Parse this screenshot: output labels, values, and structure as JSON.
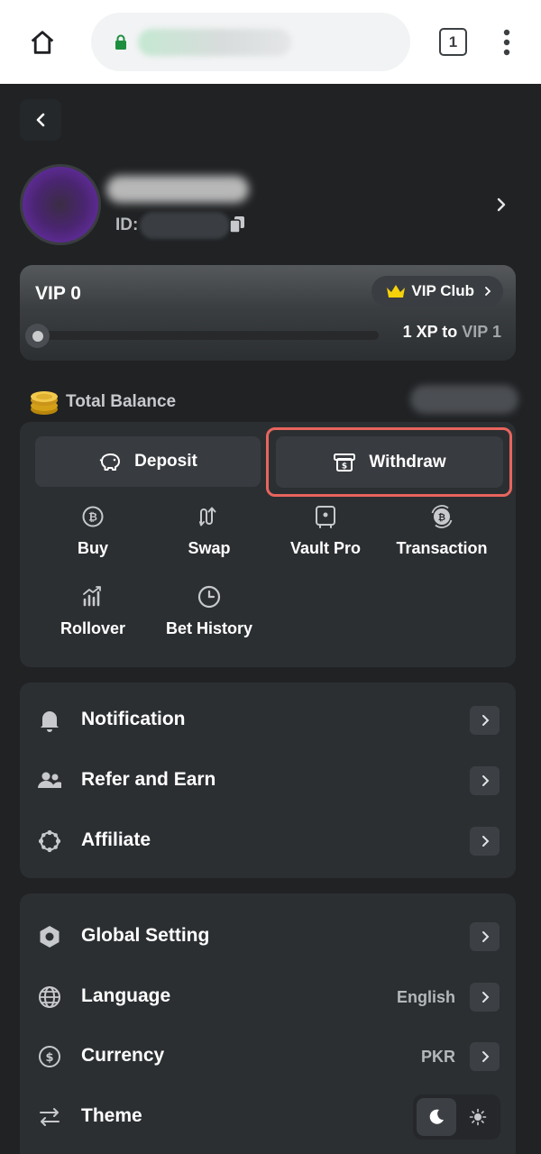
{
  "browser": {
    "tab_count": "1"
  },
  "profile": {
    "id_label": "ID:"
  },
  "vip": {
    "level": "VIP 0",
    "club_label": "VIP Club",
    "xp_amount": "1 XP to",
    "next_level": "VIP 1",
    "progress_fraction": 0.0
  },
  "balance": {
    "label": "Total Balance"
  },
  "wallet": {
    "deposit_label": "Deposit",
    "withdraw_label": "Withdraw",
    "actions": [
      {
        "label": "Buy",
        "icon": "bitcoin-coin-icon"
      },
      {
        "label": "Swap",
        "icon": "swap-arrows-icon"
      },
      {
        "label": "Vault Pro",
        "icon": "vault-icon"
      },
      {
        "label": "Transaction",
        "icon": "transaction-coin-icon"
      },
      {
        "label": "Rollover",
        "icon": "rollover-chart-icon"
      },
      {
        "label": "Bet History",
        "icon": "clock-icon"
      }
    ]
  },
  "menu1": [
    {
      "label": "Notification",
      "icon": "bell-icon"
    },
    {
      "label": "Refer and Earn",
      "icon": "users-icon"
    },
    {
      "label": "Affiliate",
      "icon": "affiliate-circle-icon"
    }
  ],
  "menu2": [
    {
      "label": "Global Setting",
      "icon": "hexagon-gear-icon"
    },
    {
      "label": "Language",
      "icon": "globe-icon",
      "value": "English"
    },
    {
      "label": "Currency",
      "icon": "dollar-circle-icon",
      "value": "PKR"
    },
    {
      "label": "Theme",
      "icon": "swap-horizontal-icon"
    }
  ],
  "colors": {
    "highlight_border": "#e8655d",
    "vip_crown": "#f5d20a",
    "lock_green": "#1e8e3e"
  }
}
